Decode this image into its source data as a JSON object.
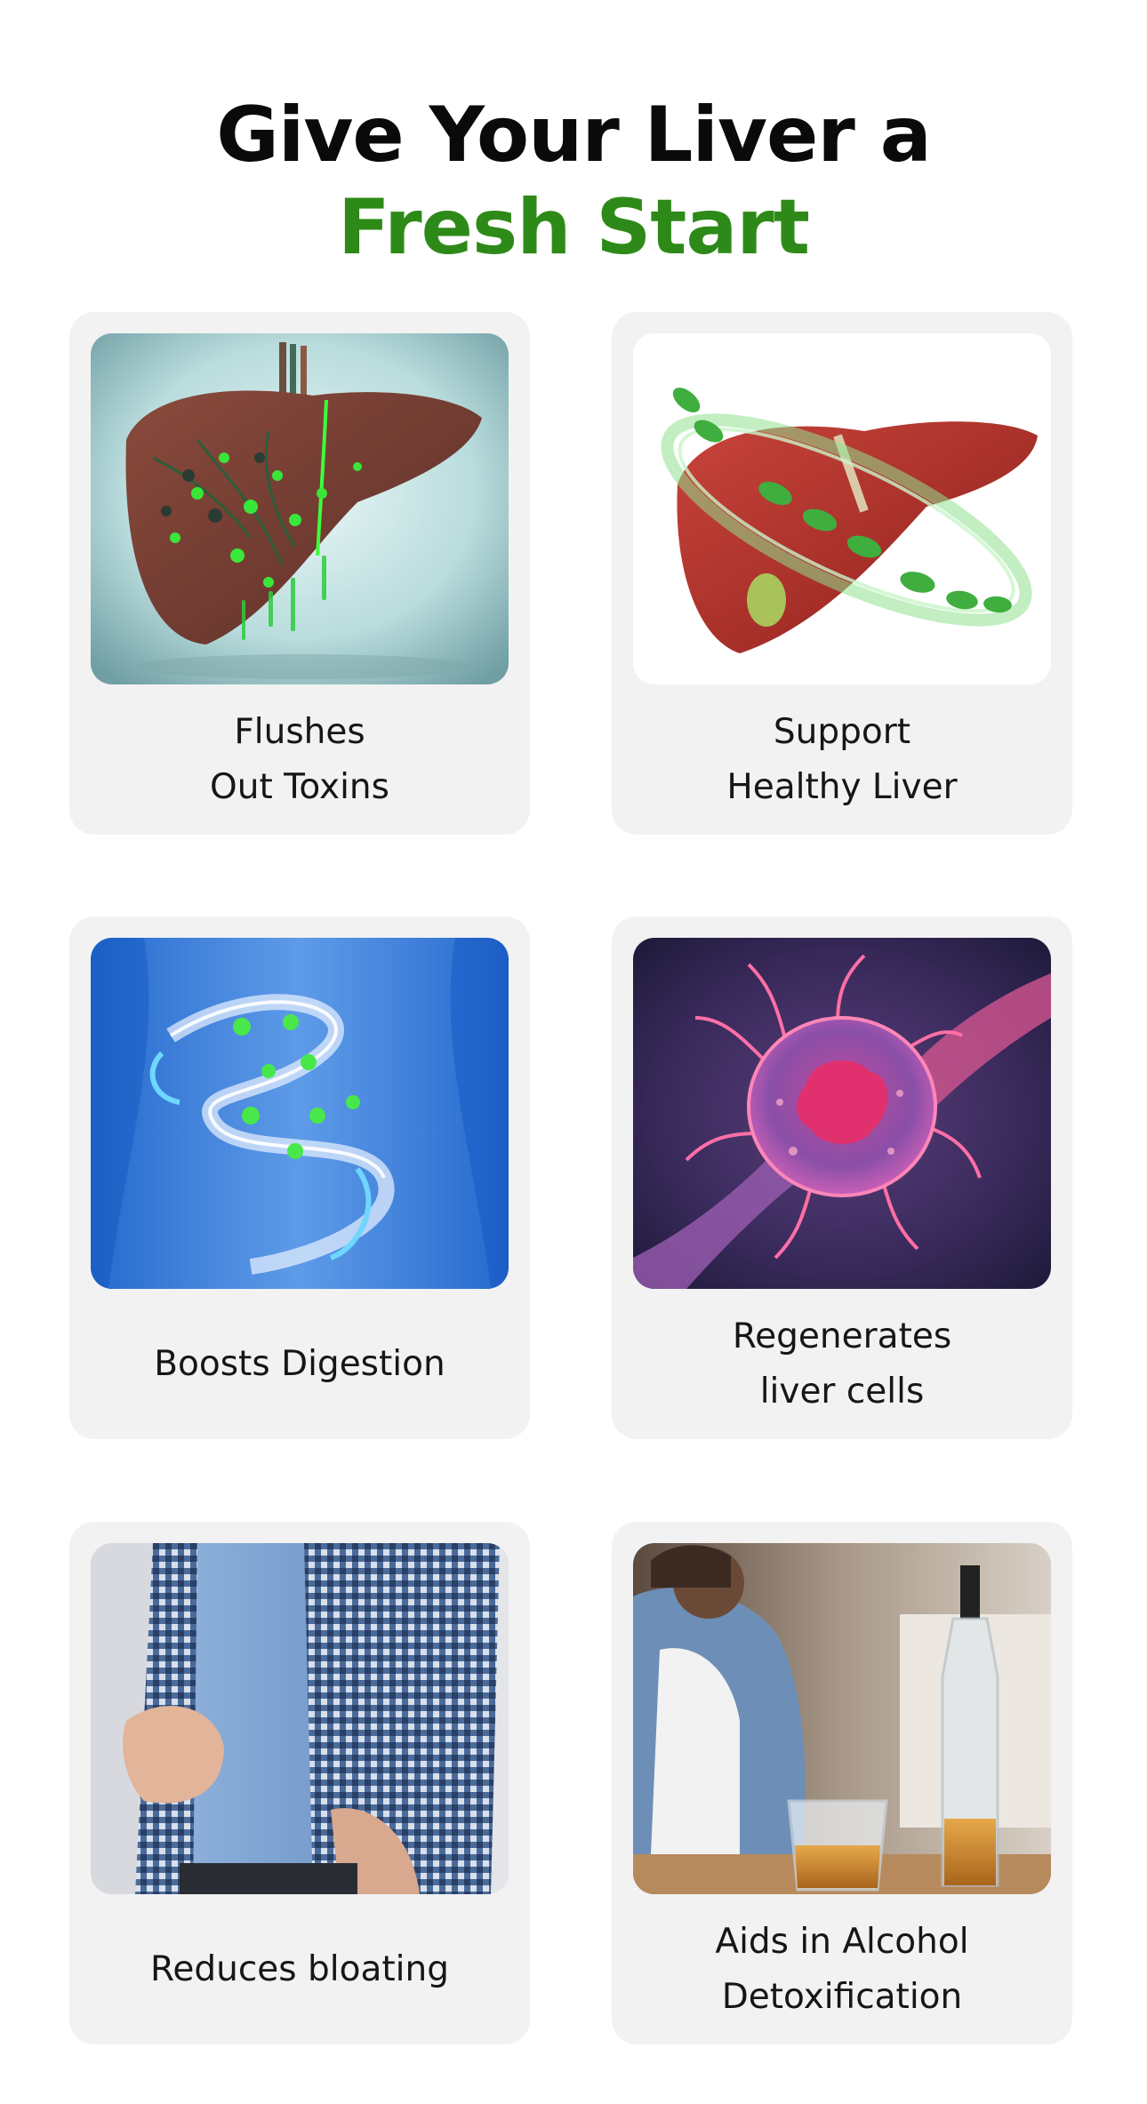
{
  "heading": {
    "line1": "Give Your Liver a",
    "line2": "Fresh Start"
  },
  "colors": {
    "accent_green": "#2e8a18",
    "card_background": "#f2f2f3",
    "heading_dark": "#0a0a0a"
  },
  "benefits": [
    {
      "line1": "Flushes",
      "line2": "Out Toxins",
      "image": "toxic-liver-illustration"
    },
    {
      "line1": "Support",
      "line2": "Healthy Liver",
      "image": "healthy-liver-with-leaves-illustration"
    },
    {
      "line1": "Boosts Digestion",
      "line2": "",
      "image": "digestive-spiral-illustration"
    },
    {
      "line1": "Regenerates",
      "line2": "liver cells",
      "image": "liver-cell-illustration"
    },
    {
      "line1": "Reduces bloating",
      "line2": "",
      "image": "bloated-stomach-photo"
    },
    {
      "line1": "Aids in Alcohol",
      "line2": "Detoxification",
      "image": "alcohol-bottle-photo"
    }
  ]
}
